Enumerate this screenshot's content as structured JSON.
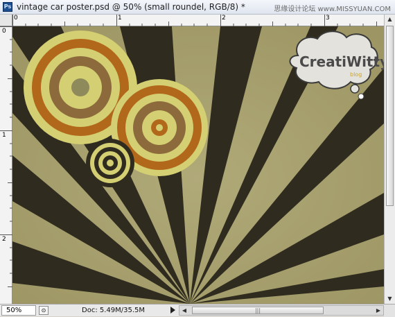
{
  "window": {
    "app_icon_text": "Ps",
    "title": "vintage car poster.psd @ 50% (small roundel, RGB/8) *",
    "watermark": "思缘设计论坛 www.MISSYUAN.COM"
  },
  "rulers": {
    "top_labels": [
      "0",
      "1",
      "2",
      "3"
    ],
    "left_labels": [
      "0",
      "1",
      "2"
    ]
  },
  "canvas": {
    "logo_text": "CreatiWitty",
    "logo_subtext": "blog",
    "colors": {
      "paper": "#a7a06e",
      "ray_dark": "#2f2c1f",
      "ring_yellow": "#d3cf72",
      "ring_orange": "#b2681b",
      "ring_brown": "#8c6a3c"
    }
  },
  "status": {
    "zoom": "50%",
    "doc_info": "Doc: 5.49M/35.5M",
    "scroll_thumb_grip": "|||"
  },
  "icons": {
    "status_menu": "status-menu-icon",
    "play": "play-arrow-icon",
    "scroll_left": "scroll-left-icon",
    "scroll_right": "scroll-right-icon",
    "scroll_up": "scroll-up-icon",
    "scroll_down": "scroll-down-icon"
  }
}
